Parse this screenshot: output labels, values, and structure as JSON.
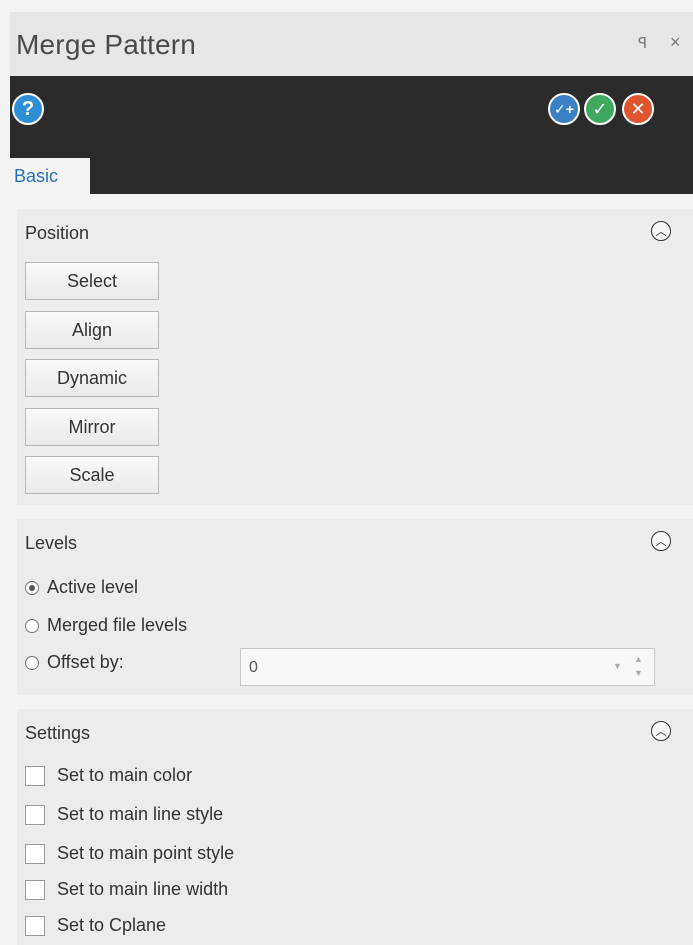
{
  "window": {
    "title": "Merge Pattern",
    "pin_icon": "pin-icon",
    "close_icon": "close-icon"
  },
  "toolbar": {
    "help_glyph": "?",
    "okplus_glyph": "✓+",
    "ok_glyph": "✓",
    "cancel_glyph": "✕",
    "colors": {
      "help": "#2f8fd6",
      "okplus": "#3b7fc4",
      "ok": "#3fa85c",
      "cancel": "#e05530"
    }
  },
  "tabs": [
    {
      "label": "Basic",
      "active": true
    }
  ],
  "position": {
    "title": "Position",
    "buttons": [
      "Select",
      "Align",
      "Dynamic",
      "Mirror",
      "Scale"
    ]
  },
  "levels": {
    "title": "Levels",
    "options": [
      "Active level",
      "Merged file levels",
      "Offset by:"
    ],
    "selected": "Active level",
    "offset_value": "0"
  },
  "settings": {
    "title": "Settings",
    "checkboxes": [
      {
        "label": "Set to main color",
        "checked": false
      },
      {
        "label": "Set to main line style",
        "checked": false
      },
      {
        "label": "Set to main point style",
        "checked": false
      },
      {
        "label": "Set to main line width",
        "checked": false
      },
      {
        "label": "Set to Cplane",
        "checked": false
      }
    ]
  }
}
